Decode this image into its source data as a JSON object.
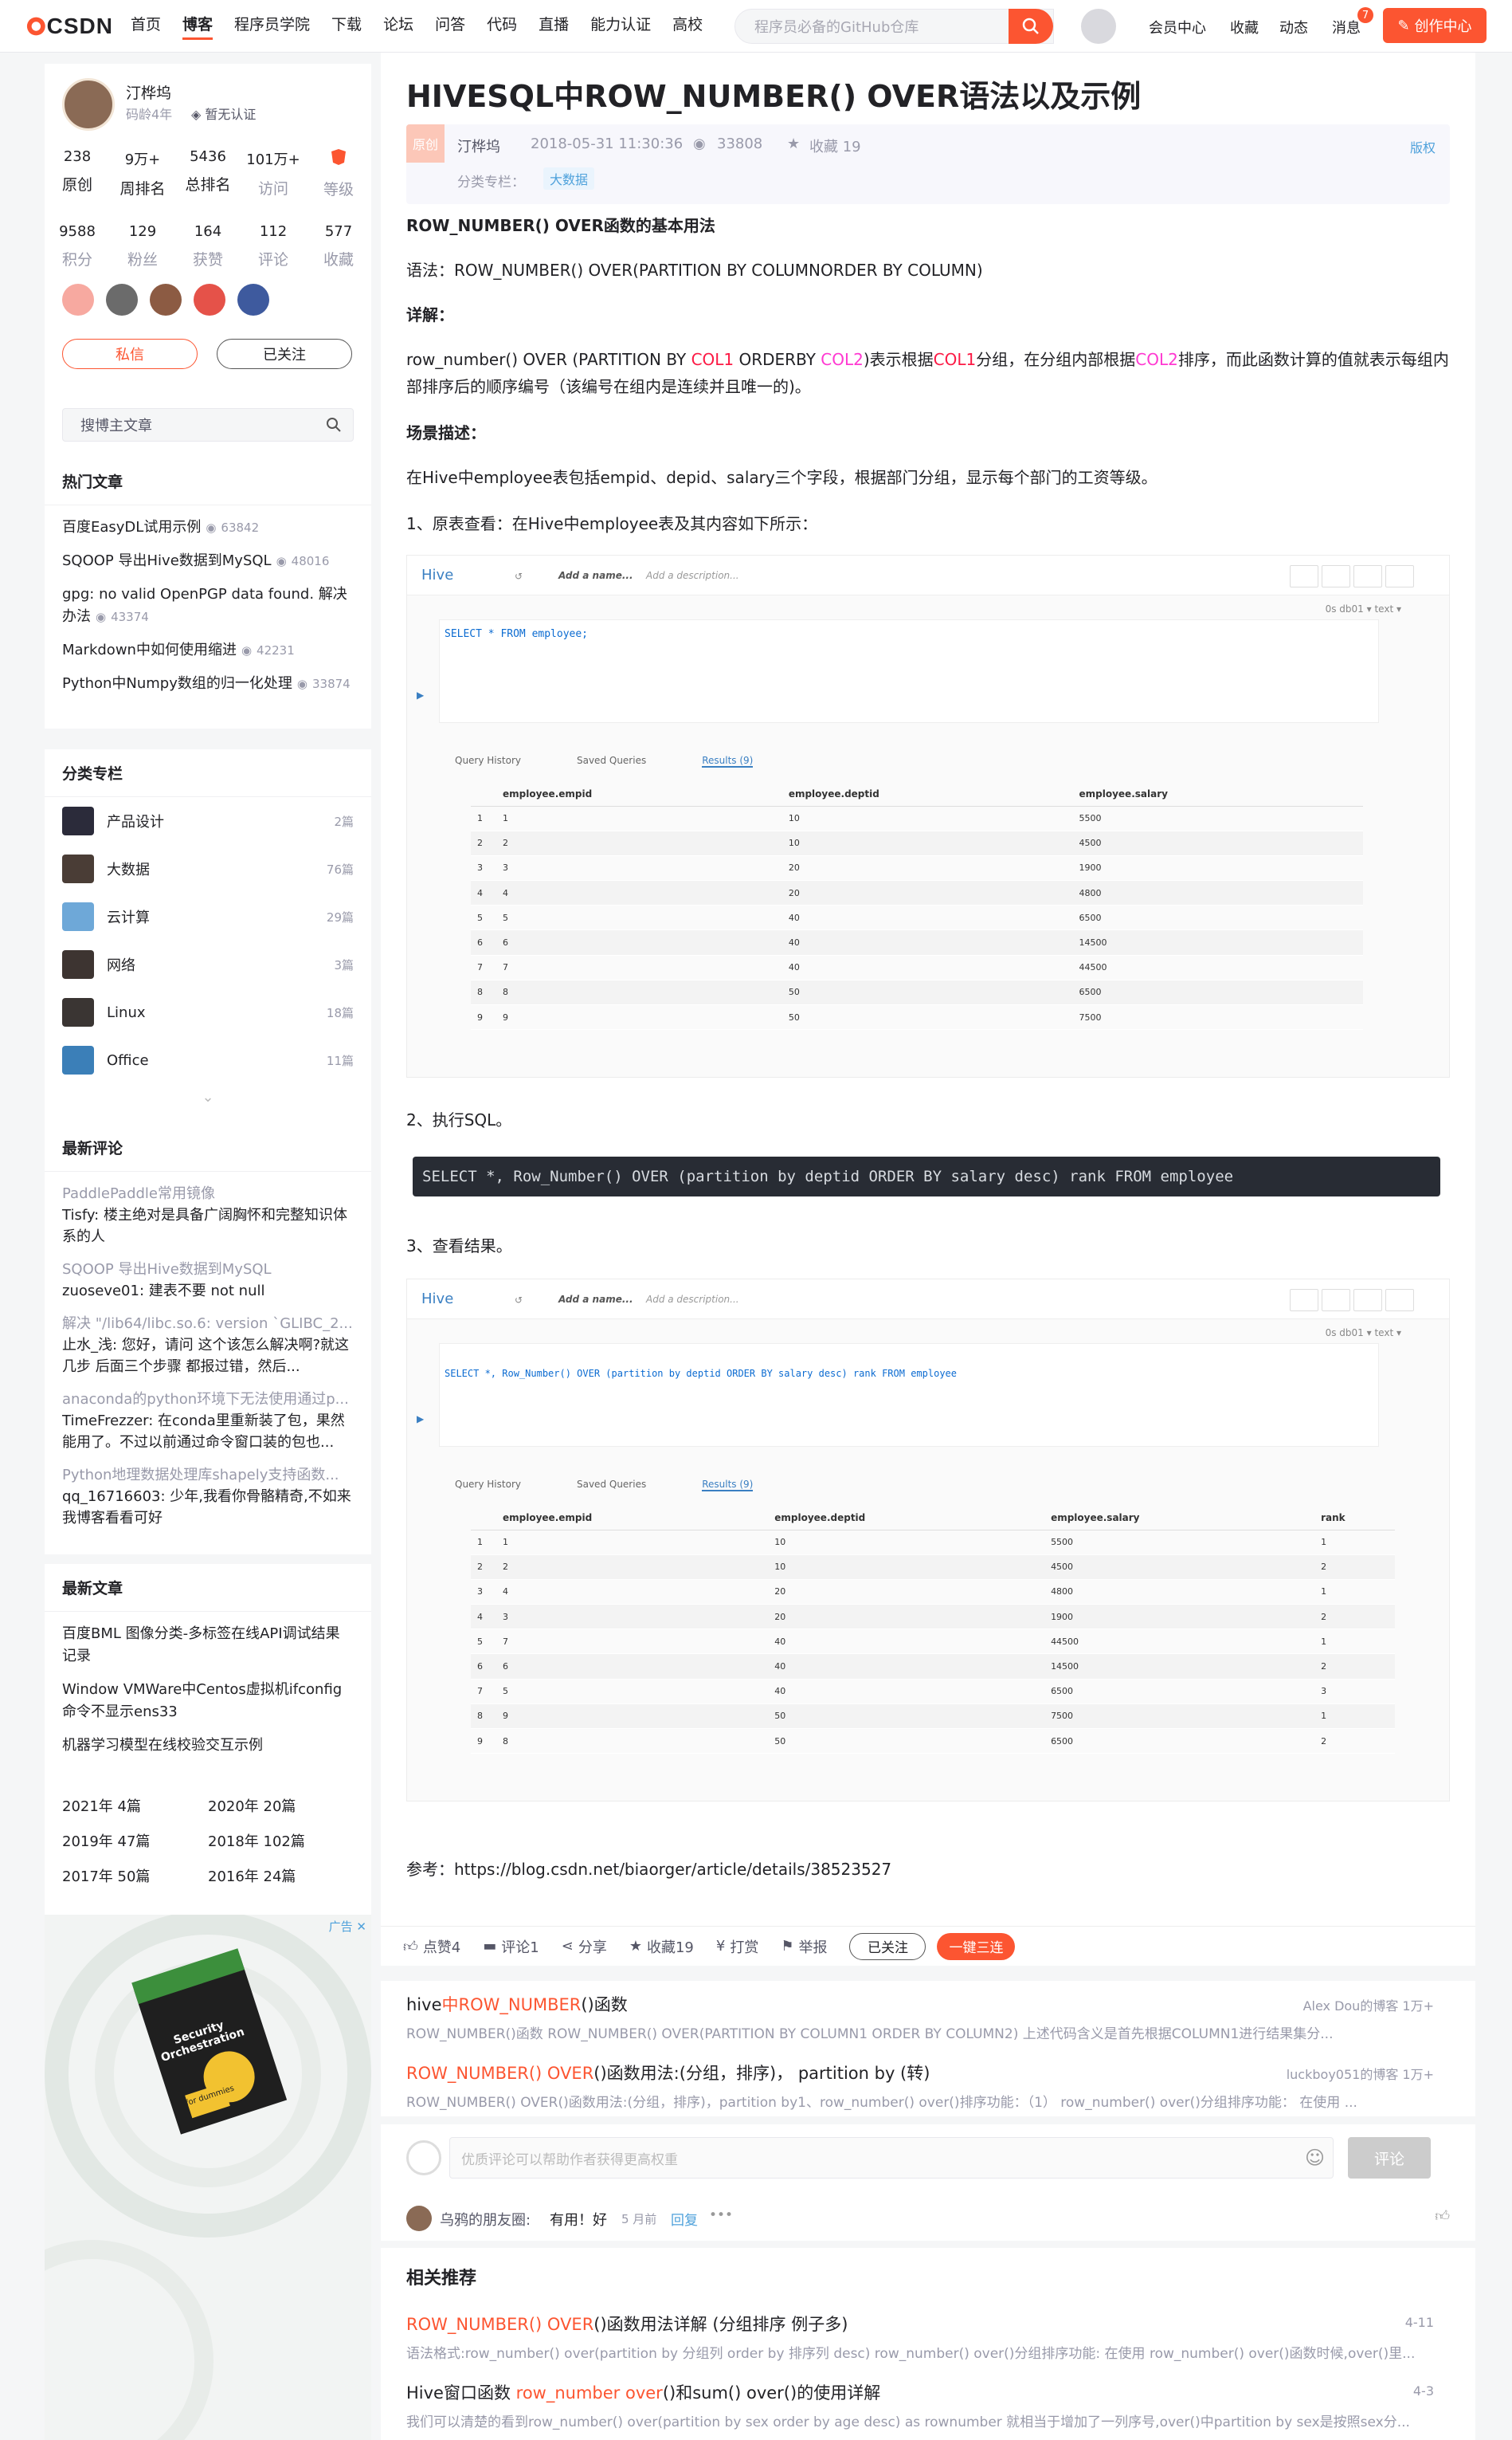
{
  "nav": {
    "brand": "CSDN",
    "items": [
      "首页",
      "博客",
      "程序员学院",
      "下载",
      "论坛",
      "问答",
      "代码",
      "直播",
      "能力认证",
      "高校"
    ],
    "search_placeholder": "程序员必备的GitHub仓库",
    "right": [
      "会员中心",
      "收藏",
      "动态",
      "消息"
    ],
    "msg_count": "7",
    "create": "创作中心"
  },
  "profile": {
    "name": "汀桦坞",
    "age": "码龄4年",
    "cert": "暂无认证",
    "row1": [
      {
        "v": "238",
        "l": "原创"
      },
      {
        "v": "9万+",
        "l": "周排名"
      },
      {
        "v": "5436",
        "l": "总排名"
      },
      {
        "v": "101万+",
        "l": "访问"
      },
      {
        "v": "",
        "l": "等级"
      }
    ],
    "row2": [
      {
        "v": "9588",
        "l": "积分"
      },
      {
        "v": "129",
        "l": "粉丝"
      },
      {
        "v": "164",
        "l": "获赞"
      },
      {
        "v": "112",
        "l": "评论"
      },
      {
        "v": "577",
        "l": "收藏"
      }
    ],
    "msg_btn": "私信",
    "follow_btn": "已关注"
  },
  "blog_search": {
    "placeholder": "搜博主文章"
  },
  "hot": {
    "title": "热门文章",
    "items": [
      {
        "t": "百度EasyDL试用示例",
        "v": "63842"
      },
      {
        "t": "SQOOP 导出Hive数据到MySQL",
        "v": "48016"
      },
      {
        "t": "gpg: no valid OpenPGP data found. 解决办法",
        "v": "43374"
      },
      {
        "t": "Markdown中如何使用缩进",
        "v": "42231"
      },
      {
        "t": "Python中Numpy数组的归一化处理",
        "v": "33874"
      }
    ]
  },
  "cats": {
    "title": "分类专栏",
    "items": [
      {
        "t": "产品设计",
        "c": "2篇",
        "color": "#2b2b3a"
      },
      {
        "t": "大数据",
        "c": "76篇",
        "color": "#4a3d36"
      },
      {
        "t": "云计算",
        "c": "29篇",
        "color": "#6ea8d8"
      },
      {
        "t": "网络",
        "c": "3篇",
        "color": "#3d3431"
      },
      {
        "t": "Linux",
        "c": "18篇",
        "color": "#3a3533"
      },
      {
        "t": "Office",
        "c": "11篇",
        "color": "#3b7fb8"
      }
    ]
  },
  "comments": {
    "title": "最新评论",
    "items": [
      {
        "a": "PaddlePaddle常用镜像",
        "b": "Tisfy: 楼主绝对是具备广阔胸怀和完整知识体系的人"
      },
      {
        "a": "SQOOP 导出Hive数据到MySQL",
        "b": "zuoseve01: 建表不要 not null"
      },
      {
        "a": "解决 \"/lib64/libc.so.6: version `GLIBC_2....",
        "b": "止水_浅: 您好，请问 这个该怎么解决啊?就这几步 后面三个步骤 都报过错，然后..."
      },
      {
        "a": "anaconda的python环境下无法使用通过p...",
        "b": "TimeFrezzer: 在conda里重新装了包，果然能用了。不过以前通过命令窗口装的包也..."
      },
      {
        "a": "Python地理数据处理库shapely支持函数...",
        "b": "qq_16716603: 少年,我看你骨骼精奇,不如来我博客看看可好"
      }
    ]
  },
  "recent": {
    "title": "最新文章",
    "items": [
      "百度BML 图像分类-多标签在线API调试结果记录",
      "Window VMWare中Centos虚拟机ifconfig命令不显示ens33",
      "机器学习模型在线校验交互示例"
    ],
    "archive": [
      "2021年 4篇",
      "2020年 20篇",
      "2019年 47篇",
      "2018年 102篇",
      "2017年 50篇",
      "2016年 24篇"
    ]
  },
  "ad": {
    "label": "广告",
    "book_title": "Security Orchestration",
    "book_sub": "for dummies"
  },
  "article": {
    "title": "HIVESQL中ROW_NUMBER() OVER语法以及示例",
    "orig": "原创",
    "author": "汀桦坞",
    "date": "2018-05-31 11:30:36",
    "views": "33808",
    "fav": "收藏 19",
    "copyright": "版权",
    "col_label": "分类专栏：",
    "col_tag": "大数据",
    "h1": "ROW_NUMBER() OVER函数的基本用法",
    "syntax": "语法：ROW_NUMBER() OVER(PARTITION BY COLUMNORDER BY COLUMN)",
    "detail": "详解：",
    "desc_a": "row_number() OVER (PARTITION BY ",
    "col1": "COL1",
    "desc_b": " ORDERBY ",
    "col2": "COL2",
    "desc_c": ")表示根据",
    "desc_d": "分组，在分组内部根据",
    "desc_e": "排序，而此函数计算的值就表示每组内部排序后的顺序编号（该编号在组内是连续并且唯一的)。",
    "scene": "场景描述：",
    "scene_text": "在Hive中employee表包括empid、depid、salary三个字段，根据部门分组，显示每个部门的工资等级。",
    "step1": "1、原表查看：在Hive中employee表及其内容如下所示：",
    "step2": "2、执行SQL。",
    "code": "SELECT *, Row_Number() OVER (partition by deptid ORDER BY salary desc) rank FROM employee",
    "step3": "3、查看结果。",
    "ref": "参考：https://blog.csdn.net/biaorger/article/details/38523527"
  },
  "shot1": {
    "app": "Hive",
    "add_name": "Add a name...",
    "add_desc": "Add a description...",
    "db": "0s   db01 ▾    text ▾",
    "sql": "SELECT * FROM employee;",
    "tabs": [
      "Query History",
      "Saved Queries",
      "Results (9)"
    ],
    "cols": [
      "employee.empid",
      "employee.deptid",
      "employee.salary"
    ],
    "rows": [
      [
        "1",
        "1",
        "10",
        "5500"
      ],
      [
        "2",
        "2",
        "10",
        "4500"
      ],
      [
        "3",
        "3",
        "20",
        "1900"
      ],
      [
        "4",
        "4",
        "20",
        "4800"
      ],
      [
        "5",
        "5",
        "40",
        "6500"
      ],
      [
        "6",
        "6",
        "40",
        "14500"
      ],
      [
        "7",
        "7",
        "40",
        "44500"
      ],
      [
        "8",
        "8",
        "50",
        "6500"
      ],
      [
        "9",
        "9",
        "50",
        "7500"
      ]
    ]
  },
  "shot2": {
    "app": "Hive",
    "add_name": "Add a name...",
    "add_desc": "Add a description...",
    "db": "0s   db01 ▾    text ▾",
    "sql": "SELECT *, Row_Number() OVER (partition by deptid ORDER BY salary desc) rank FROM employee",
    "tabs": [
      "Query History",
      "Saved Queries",
      "Results (9)"
    ],
    "cols": [
      "employee.empid",
      "employee.deptid",
      "employee.salary",
      "rank"
    ],
    "rows": [
      [
        "1",
        "1",
        "10",
        "5500",
        "1"
      ],
      [
        "2",
        "2",
        "10",
        "4500",
        "2"
      ],
      [
        "3",
        "4",
        "20",
        "4800",
        "1"
      ],
      [
        "4",
        "3",
        "20",
        "1900",
        "2"
      ],
      [
        "5",
        "7",
        "40",
        "44500",
        "1"
      ],
      [
        "6",
        "6",
        "40",
        "14500",
        "2"
      ],
      [
        "7",
        "5",
        "40",
        "6500",
        "3"
      ],
      [
        "8",
        "9",
        "50",
        "7500",
        "1"
      ],
      [
        "9",
        "8",
        "50",
        "6500",
        "2"
      ]
    ]
  },
  "toolbar": {
    "like": "点赞4",
    "comment": "评论1",
    "share": "分享",
    "fav": "收藏19",
    "tip": "打赏",
    "report": "举报",
    "follow": "已关注",
    "triple": "一键三连"
  },
  "rel1": [
    {
      "h_pre": "hive",
      "h_r": "中ROW_NUMBER",
      "h_post": "()函数",
      "meta": "Alex Dou的博客   1万+",
      "s": "ROW_NUMBER()函数 ROW_NUMBER() OVER(PARTITION BY COLUMN1 ORDER BY COLUMN2) 上述代码含义是首先根据COLUMN1进行结果集分..."
    },
    {
      "h_pre": "",
      "h_r": "ROW_NUMBER() OVER",
      "h_post": "()函数用法:(分组，排序)， partition by (转)",
      "meta": "luckboy051的博客   1万+",
      "s": "ROW_NUMBER() OVER()函数用法:(分组，排序)，partition by1、row_number() over()排序功能：（1） row_number() over()分组排序功能：    在使用 ..."
    }
  ],
  "comment_box": {
    "placeholder": "优质评论可以帮助作者获得更高权重",
    "submit": "评论",
    "user": "乌鸦的朋友圈:",
    "text": "有用！好",
    "time": "5 月前",
    "reply": "回复"
  },
  "rel2": {
    "title": "相关推荐",
    "items": [
      {
        "h_r": "ROW_NUMBER() OVER",
        "h_post": "()函数用法详解 (分组排序 例子多)",
        "meta": "4-11",
        "s": "语法格式:row_number() over(partition by 分组列 order by 排序列 desc) row_number() over()分组排序功能: 在使用 row_number() over()函数时候,over()里..."
      },
      {
        "h_pre": "Hive窗口函数 ",
        "h_r": "row_number over",
        "h_post": "()和sum() over()的使用详解",
        "meta": "4-3",
        "s": "我们可以清楚的看到row_number() over(partition by sex order by age desc) as rownumber 就相当于增加了一列序号,over()中partition by sex是按照sex分..."
      }
    ]
  },
  "colors": {
    "accent": "#fc5531",
    "link": "#4ea1db",
    "highlight_red": "#fc1944",
    "highlight_pink": "#ff38d1"
  }
}
